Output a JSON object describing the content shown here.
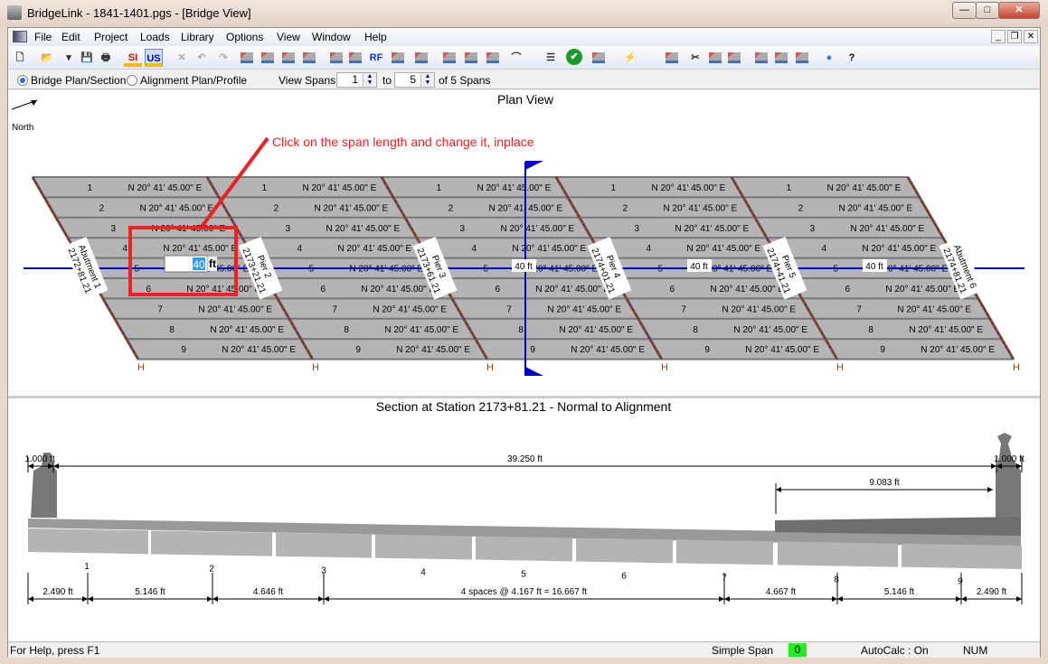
{
  "window": {
    "title": "BridgeLink - 1841-1401.pgs - [Bridge View]"
  },
  "menu": [
    "File",
    "Edit",
    "Project",
    "Loads",
    "Library",
    "Options",
    "View",
    "Window",
    "Help"
  ],
  "toolbar": {
    "icons": [
      "new-file-icon",
      "open-folder-icon",
      "dropdown-arrow-icon",
      "save-icon",
      "print-icon",
      "si-units-icon",
      "us-units-icon",
      "delete-icon",
      "undo-icon",
      "redo-icon",
      "edit-bridge-icon",
      "edit-deck-icon",
      "edit-girder-icon",
      "edit-pier-icon",
      "edit-loads-icon",
      "truck-icon",
      "rating-factor-icon",
      "girder-stress-icon",
      "library-icon",
      "section-view-icon",
      "girder-view-icon",
      "bearing-view-icon",
      "graph-icon",
      "report-icon",
      "check-icon",
      "engineer-icon",
      "lightning-icon",
      "copy-girder-icon",
      "cut-icon",
      "copy-icon",
      "paste-icon",
      "align-icon",
      "grid-icon",
      "distribute-icon",
      "globe-icon",
      "help-icon"
    ],
    "si_label": "SI",
    "us_label": "US",
    "rf_label": "RF"
  },
  "options": {
    "view_modes": [
      "Bridge Plan/Section",
      "Alignment Plan/Profile"
    ],
    "selected_mode": "Bridge Plan/Section",
    "view_spans_label": "View Spans",
    "span_from": "1",
    "to_label": "to",
    "span_to": "5",
    "of_label": "of 5 Spans"
  },
  "plan": {
    "title": "Plan View",
    "north_label": "North",
    "annotation": "Click on the span length and change it, inplace",
    "bearing": "N 20° 41' 45.00\" E",
    "girders": [
      "1",
      "2",
      "3",
      "4",
      "5",
      "6",
      "7",
      "8",
      "9"
    ],
    "supports": [
      {
        "name": "Abutment 1",
        "station": "2172+81.21"
      },
      {
        "name": "Pier 2",
        "station": "2173+21.21"
      },
      {
        "name": "Pier 3",
        "station": "2173+61.21"
      },
      {
        "name": "Pier 4",
        "station": "2174+01.21"
      },
      {
        "name": "Pier 5",
        "station": "2174+41.21"
      },
      {
        "name": "Abutment 6",
        "station": "2174+81.21"
      }
    ],
    "span_lengths": [
      "40 ft",
      "40 ft",
      "40 ft",
      "40 ft"
    ],
    "edit_value": "40",
    "edit_unit": "ft",
    "bearing_marker": "H"
  },
  "section": {
    "title": "Section at Station 2173+81.21 - Normal to Alignment",
    "girders": [
      "1",
      "2",
      "3",
      "4",
      "5",
      "6",
      "7",
      "8",
      "9"
    ],
    "top_dims": [
      "1.000 ft",
      "39.250 ft",
      "1.000 ft",
      "9.083 ft"
    ],
    "bottom_dims": [
      "2.490 ft",
      "5.146 ft",
      "4.646 ft",
      "4 spaces @ 4.167 ft = 16.667 ft",
      "4.667 ft",
      "5.146 ft",
      "2.490 ft"
    ]
  },
  "status": {
    "help": "For Help, press F1",
    "mode": "Simple Span",
    "count": "0",
    "autocalc": "AutoCalc : On",
    "num": "NUM"
  },
  "colors": {
    "deck": "#b4b4b4",
    "alignment": "#0000cc",
    "annotation": "#ee2222",
    "count_bg": "#22ee22"
  }
}
